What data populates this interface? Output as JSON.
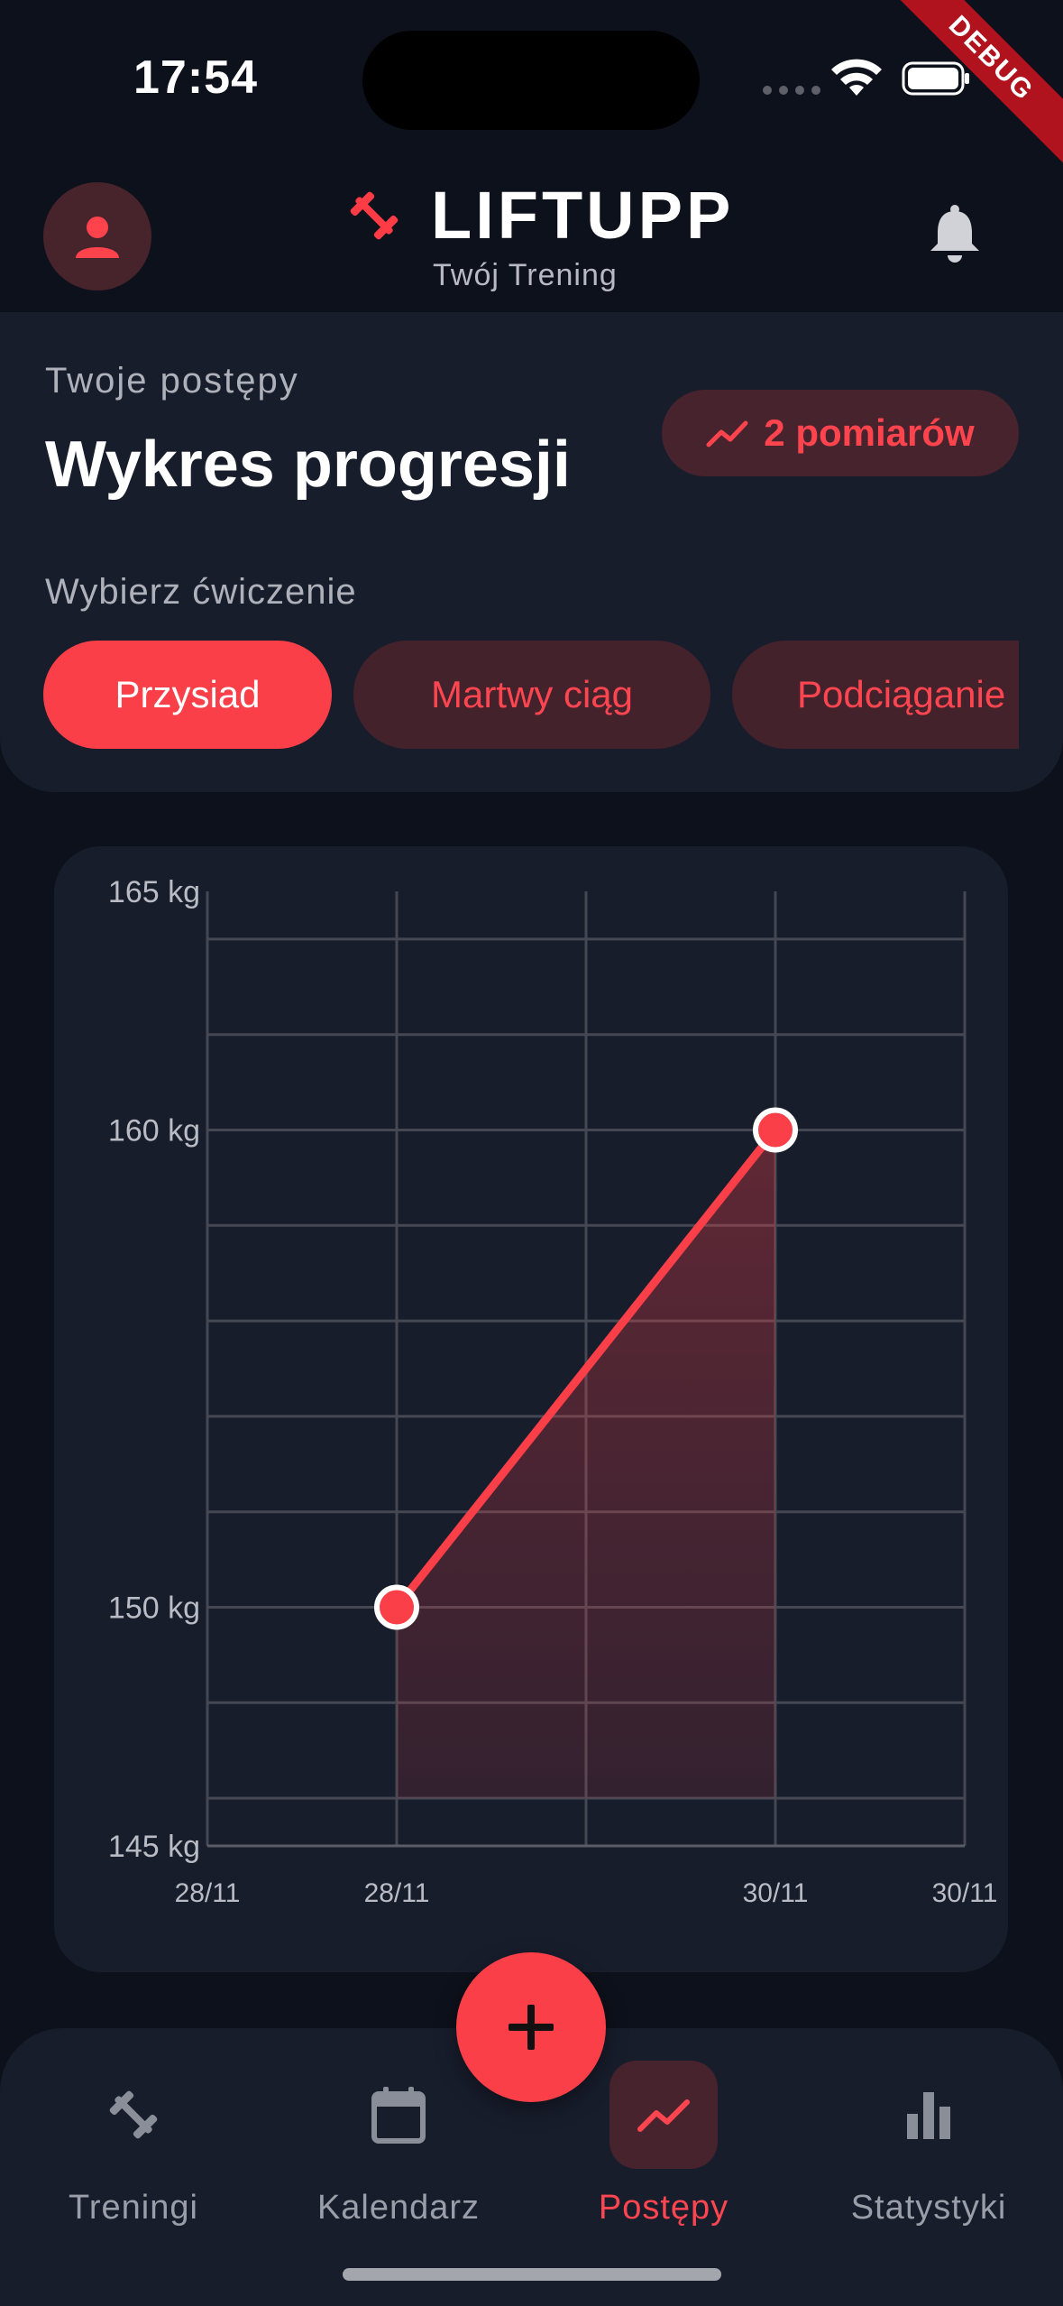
{
  "status_bar": {
    "time": "17:54",
    "debug_label": "DEBUG"
  },
  "header": {
    "brand": "LIFTUPP",
    "subtitle": "Twój Trening"
  },
  "progress": {
    "eyebrow": "Twoje postępy",
    "title": "Wykres progresji",
    "badge": "2 pomiarów",
    "select_label": "Wybierz ćwiczenie",
    "exercises": [
      "Przysiad",
      "Martwy ciąg",
      "Podciąganie"
    ],
    "selected_exercise": "Przysiad"
  },
  "chart_data": {
    "type": "line",
    "x_tick_labels": [
      "28/11",
      "28/11",
      "30/11",
      "30/11"
    ],
    "y_tick_labels": [
      "165 kg",
      "160 kg",
      "150 kg",
      "145 kg"
    ],
    "ylim": [
      145,
      165
    ],
    "points": [
      {
        "x": "28/11",
        "y": 150
      },
      {
        "x": "30/11",
        "y": 160
      }
    ],
    "grid": true,
    "line_color": "#fb3f48"
  },
  "nav": {
    "items": [
      {
        "label": "Treningi",
        "icon": "dumbbell-icon"
      },
      {
        "label": "Kalendarz",
        "icon": "calendar-icon"
      },
      {
        "label": "Postępy",
        "icon": "trending-up-icon"
      },
      {
        "label": "Statystyki",
        "icon": "bar-chart-icon"
      }
    ],
    "active": "Postępy"
  },
  "colors": {
    "accent": "#fb3f48",
    "background": "#0d111b",
    "card": "#181d2c"
  }
}
